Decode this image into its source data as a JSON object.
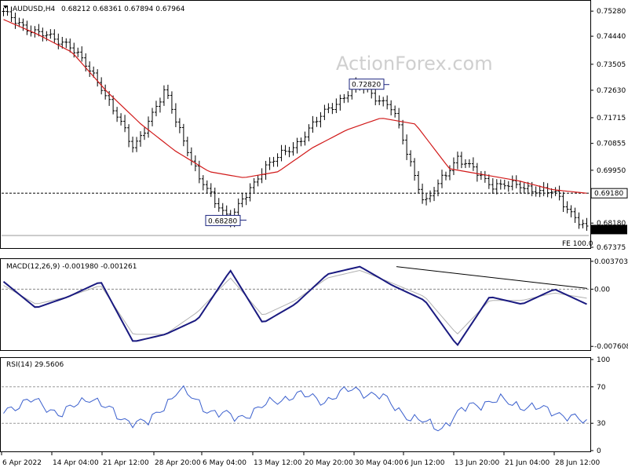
{
  "watermark": "ActionForex.com",
  "chart_data": {
    "type": "line",
    "main": {
      "title": "AUDUSD,H4",
      "ohlc": "0.68212 0.68361 0.67894 0.67964",
      "y_ticks": [
        0.7528,
        0.7444,
        0.735,
        0.7263,
        0.7171,
        0.7085,
        0.6995,
        0.6818,
        0.6737
      ],
      "y_tick_labels": [
        "0.75280",
        "0.74440",
        "0.73505",
        "0.72630",
        "0.71715",
        "0.70855",
        "0.69950",
        "0.68180",
        "0.67375"
      ],
      "ylim": [
        0.6737,
        0.756
      ],
      "x": [
        "6 Apr 2022",
        "14 Apr 04:00",
        "21 Apr 12:00",
        "28 Apr 20:00",
        "6 May 04:00",
        "13 May 12:00",
        "20 May 20:00",
        "30 May 04:00",
        "6 Jun 12:00",
        "13 Jun 20:00",
        "21 Jun 04:00",
        "28 Jun 12:00"
      ],
      "price_approx": [
        0.752,
        0.7455,
        0.742,
        0.728,
        0.707,
        0.726,
        0.697,
        0.6828,
        0.7,
        0.708,
        0.72,
        0.7282,
        0.72,
        0.688,
        0.704,
        0.695,
        0.694,
        0.6918,
        0.6796
      ],
      "sma_approx": [
        0.75,
        0.745,
        0.739,
        0.726,
        0.715,
        0.706,
        0.699,
        0.697,
        0.699,
        0.707,
        0.713,
        0.717,
        0.715,
        0.7,
        0.698,
        0.696,
        0.693,
        0.6918
      ],
      "level_line": 0.6918,
      "level_line_label": "0.69180",
      "last_price_label": "0.67964",
      "fe_label": "FE 100.0",
      "annotations": [
        {
          "text": "0.72820",
          "value": 0.7282
        },
        {
          "text": "0.68280",
          "value": 0.6828
        }
      ]
    },
    "macd": {
      "title": "MACD(12,26,9) -0.001980 -0.001261",
      "y_tick_labels": [
        "0.003703",
        "0.00",
        "-0.007608"
      ],
      "ylim": [
        -0.008,
        0.0039
      ],
      "macd_approx": [
        0.001,
        -0.0025,
        -0.001,
        0.001,
        -0.007,
        -0.006,
        -0.004,
        0.0025,
        -0.0045,
        -0.002,
        0.002,
        0.003,
        0.0005,
        -0.0015,
        -0.0075,
        -0.001,
        -0.002,
        0.0,
        -0.002
      ],
      "signal_approx": [
        0.0005,
        -0.002,
        -0.001,
        0.0005,
        -0.006,
        -0.006,
        -0.003,
        0.0015,
        -0.0035,
        -0.0015,
        0.0015,
        0.0025,
        0.0008,
        -0.001,
        -0.006,
        -0.0015,
        -0.0015,
        -0.0005,
        -0.0012
      ]
    },
    "rsi": {
      "title": "RSI(14) 29.5606",
      "y_tick_labels": [
        "100",
        "70",
        "30",
        "0"
      ],
      "levels": [
        70,
        30
      ],
      "ylim": [
        0,
        100
      ],
      "rsi_approx": [
        45,
        55,
        40,
        60,
        35,
        30,
        68,
        45,
        35,
        50,
        62,
        55,
        68,
        58,
        35,
        25,
        50,
        55,
        48,
        42,
        30
      ]
    }
  }
}
